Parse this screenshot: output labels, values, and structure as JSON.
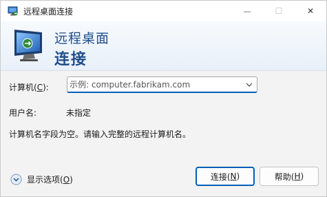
{
  "window": {
    "title": "远程桌面连接",
    "minimize_glyph": "—",
    "maximize_glyph": "☐",
    "close_glyph": "✕"
  },
  "banner": {
    "line1": "远程桌面",
    "line2": "连接",
    "icon": "remote-desktop-icon"
  },
  "form": {
    "computer_label": "计算机(",
    "computer_label_key": "C",
    "computer_label_end": "):",
    "computer_placeholder": "示例: computer.fabrikam.com",
    "user_label": "用户名:",
    "user_value": "未指定",
    "message": "计算机名字段为空。请输入完整的远程计算机名。"
  },
  "footer": {
    "options_label": "显示选项(",
    "options_key": "O",
    "options_end": ")",
    "connect_label": "连接(",
    "connect_key": "N",
    "connect_end": ")",
    "help_label": "帮助(",
    "help_key": "H",
    "help_end": ")"
  },
  "colors": {
    "accent": "#005fb8",
    "banner_text": "#1f4e8c"
  }
}
